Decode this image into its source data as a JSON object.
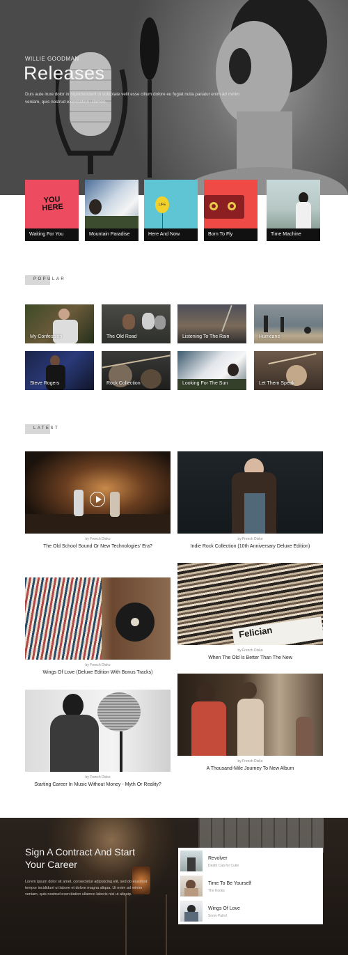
{
  "hero": {
    "artist": "WILLIE GOODMAN",
    "title": "Releases",
    "description": "Duis aute irure dolor in reprehenderit in voluptate velit esse cillum dolore eu fugiat nulla pariatur enim ad minim veniam, quis nostrud exercitation ullamco."
  },
  "releases": [
    {
      "label": "Waiting For You",
      "art_text": "YOU HERE"
    },
    {
      "label": "Mountain Paradise"
    },
    {
      "label": "Here And Now",
      "art_text": "LIFE"
    },
    {
      "label": "Born To Fly"
    },
    {
      "label": "Time Machine"
    }
  ],
  "popular": {
    "tag": "POPULAR",
    "items": [
      "My Confession",
      "The Old Road",
      "Listening To The Rain",
      "Hurricane",
      "Steve Rogers",
      "Rock Collection",
      "Looking For The Sun",
      "Let Them Speak"
    ]
  },
  "latest": {
    "tag": "LATEST",
    "posts": [
      {
        "by": "by French Disko",
        "title": "The Old School Sound Or New Technologies' Era?"
      },
      {
        "by": "by French Disko",
        "title": "Indie Rock Collection (10th Anniversary Deluxe Edition)"
      },
      {
        "by": "by French Disko",
        "title": "Wings Of Love (Deluxe Edition With Bonus Tracks)"
      },
      {
        "by": "by French Disko",
        "title": "When The Old Is Better Than The New"
      },
      {
        "by": "by French Disko",
        "title": "Starting Career In Music Without Money - Myth Or Reality?"
      },
      {
        "by": "by French Disko",
        "title": "A Thousand-Mile Journey To New Album"
      }
    ]
  },
  "contract": {
    "title": "Sign A Contract And Start Your Career",
    "description": "Lorem ipsum dolor sit amet, consectetur adipisicing elit, sed do eiusmod tempor incididunt ut labore et dolore magna aliqua. Ut enim ad minim veniam, quis nostrud exercitation ullamco laboris nisi ut aliquip.",
    "playlist": [
      {
        "title": "Revolver",
        "subtitle": "Death Cab for Cutie"
      },
      {
        "title": "Time To Be Yourself",
        "subtitle": "The Kooks"
      },
      {
        "title": "Wings Of Love",
        "subtitle": "Snow Patrol"
      }
    ]
  },
  "misc": {
    "vinyl_crate_label": "Felician"
  }
}
